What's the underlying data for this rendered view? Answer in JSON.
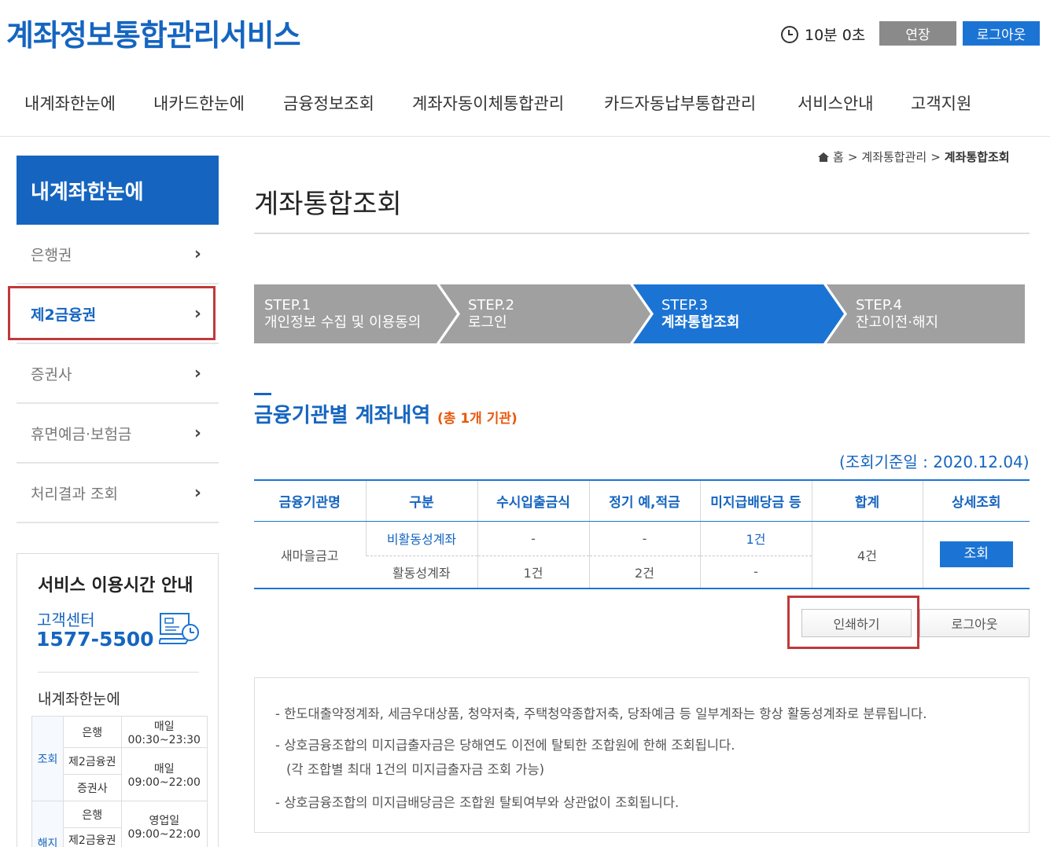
{
  "header": {
    "logo": "계좌정보통합관리서비스",
    "timer": "10분 0초",
    "extend_label": "연장",
    "logout_label": "로그아웃"
  },
  "gnb": [
    "내계좌한눈에",
    "내카드한눈에",
    "금융정보조회",
    "계좌자동이체통합관리",
    "카드자동납부통합관리",
    "서비스안내",
    "고객지원"
  ],
  "sidebar": {
    "title": "내계좌한눈에",
    "items": [
      {
        "label": "은행권"
      },
      {
        "label": "제2금융권"
      },
      {
        "label": "증권사"
      },
      {
        "label": "휴면예금·보험금"
      },
      {
        "label": "처리결과 조회"
      }
    ],
    "service": {
      "title": "서비스 이용시간 안내",
      "center_label": "고객센터",
      "phone": "1577-5500",
      "sub_title": "내계좌한눈에",
      "rows": {
        "group1": "조회",
        "bank": "은행",
        "bank_time_day": "매일",
        "bank_time": "00:30~23:30",
        "second": "제2금융권",
        "second_time_day": "매일",
        "second_time": "09:00~22:00",
        "stock": "증권사",
        "group2": "해지",
        "bank2": "은행",
        "bank2_time_day": "영업일",
        "bank2_time": "09:00~22:00",
        "second2": "제2금융권"
      }
    }
  },
  "breadcrumb": {
    "home": "홈",
    "sep": ">",
    "level1": "계좌통합관리",
    "current": "계좌통합조회"
  },
  "page_title": "계좌통합조회",
  "steps": [
    {
      "num": "STEP.1",
      "name": "개인정보 수집 및 이용동의"
    },
    {
      "num": "STEP.2",
      "name": "로그인"
    },
    {
      "num": "STEP.3",
      "name": "계좌통합조회"
    },
    {
      "num": "STEP.4",
      "name": "잔고이전·해지"
    }
  ],
  "section": {
    "title": "금융기관별 계좌내역",
    "count": "(총 1개 기관)",
    "ref_date": "(조회기준일 : 2020.12.04)"
  },
  "table": {
    "headers": [
      "금융기관명",
      "구분",
      "수시입출금식",
      "정기 예,적금",
      "미지급배당금 등",
      "합계",
      "상세조회"
    ],
    "institution": "새마을금고",
    "row1": {
      "type": "비활동성계좌",
      "demand": "-",
      "savings": "-",
      "dividend": "1건"
    },
    "row2": {
      "type": "활동성계좌",
      "demand": "1건",
      "savings": "2건",
      "dividend": "-"
    },
    "total": "4건",
    "view_label": "조회"
  },
  "actions": {
    "print_label": "인쇄하기",
    "logout_label": "로그아웃"
  },
  "notices": [
    "- 한도대출약정계좌, 세금우대상품, 청약저축, 주택청약종합저축, 당좌예금 등 일부계좌는 항상 활동성계좌로 분류됩니다.",
    "- 상호금융조합의 미지급출자금은 당해연도 이전에 탈퇴한 조합원에 한해 조회됩니다.",
    "(각 조합별 최대 1건의 미지급출자금 조회 가능)",
    "- 상호금융조합의 미지급배당금은 조합원 탈퇴여부와 상관없이 조회됩니다."
  ],
  "colors": {
    "brand": "#1565c0",
    "button_blue": "#1b74d4",
    "step_gray": "#a0a0a0",
    "highlight": "#c0393b",
    "count_orange": "#e8590c"
  }
}
